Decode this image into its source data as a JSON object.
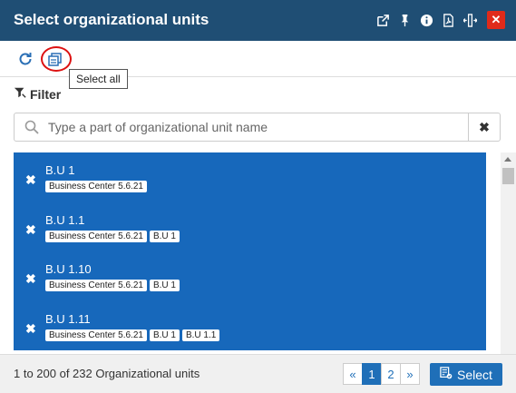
{
  "window": {
    "title": "Select organizational units"
  },
  "titlebar_icons": [
    "external-link-icon",
    "pin-icon",
    "info-icon",
    "pdf-icon",
    "resize-horizontal-icon",
    "close-icon"
  ],
  "close_glyph": "✕",
  "toolbar": {
    "refresh_icon": "refresh-icon",
    "select_all_icon": "copy-icon",
    "tooltip": "Select all"
  },
  "filter": {
    "label": "Filter",
    "icon": "filter-icon"
  },
  "search": {
    "placeholder": "Type a part of organizational unit name",
    "value": "",
    "clear_glyph": "✖"
  },
  "units": [
    {
      "name": "B.U 1",
      "path": [
        "Business Center 5.6.21"
      ]
    },
    {
      "name": "B.U 1.1",
      "path": [
        "Business Center 5.6.21",
        "B.U 1"
      ]
    },
    {
      "name": "B.U 1.10",
      "path": [
        "Business Center 5.6.21",
        "B.U 1"
      ]
    },
    {
      "name": "B.U 1.11",
      "path": [
        "Business Center 5.6.21",
        "B.U 1",
        "B.U 1.1"
      ]
    }
  ],
  "row_remove_glyph": "✖",
  "footer": {
    "count_text": "1 to 200 of 232 Organizational units",
    "pager": {
      "prev": "«",
      "pages": [
        "1",
        "2"
      ],
      "active_page": "1",
      "next": "»"
    },
    "select_label": "Select"
  },
  "colors": {
    "titlebar": "#1f4e74",
    "selected_row": "#1768bb",
    "accent": "#1f6fb8",
    "close": "#e02a1a",
    "highlight": "#dd1111"
  }
}
